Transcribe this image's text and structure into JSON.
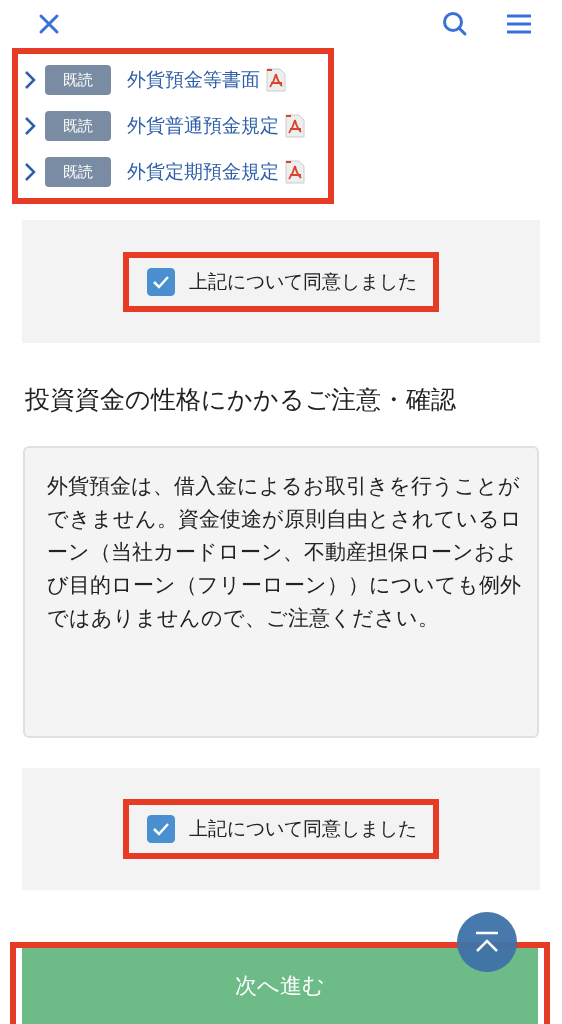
{
  "documents": {
    "highlighted": true,
    "items": [
      {
        "badge": "既読",
        "title": "外貨預金等書面"
      },
      {
        "badge": "既読",
        "title": "外貨普通預金規定"
      },
      {
        "badge": "既読",
        "title": "外貨定期預金規定"
      }
    ]
  },
  "consent_1": {
    "label": "上記について同意しました",
    "checked": true,
    "highlighted": true
  },
  "section": {
    "heading": "投資資金の性格にかかるご注意・確認",
    "notice": "外貨預金は、借入金によるお取引きを行うことができません。資金使途が原則自由とされているローン（当社カードローン、不動産担保ローンおよび目的ローン（フリーローン））についても例外ではありませんので、ご注意ください。"
  },
  "consent_2": {
    "label": "上記について同意しました",
    "checked": true,
    "highlighted": true
  },
  "next_button": {
    "label": "次へ進む",
    "highlighted": true
  }
}
